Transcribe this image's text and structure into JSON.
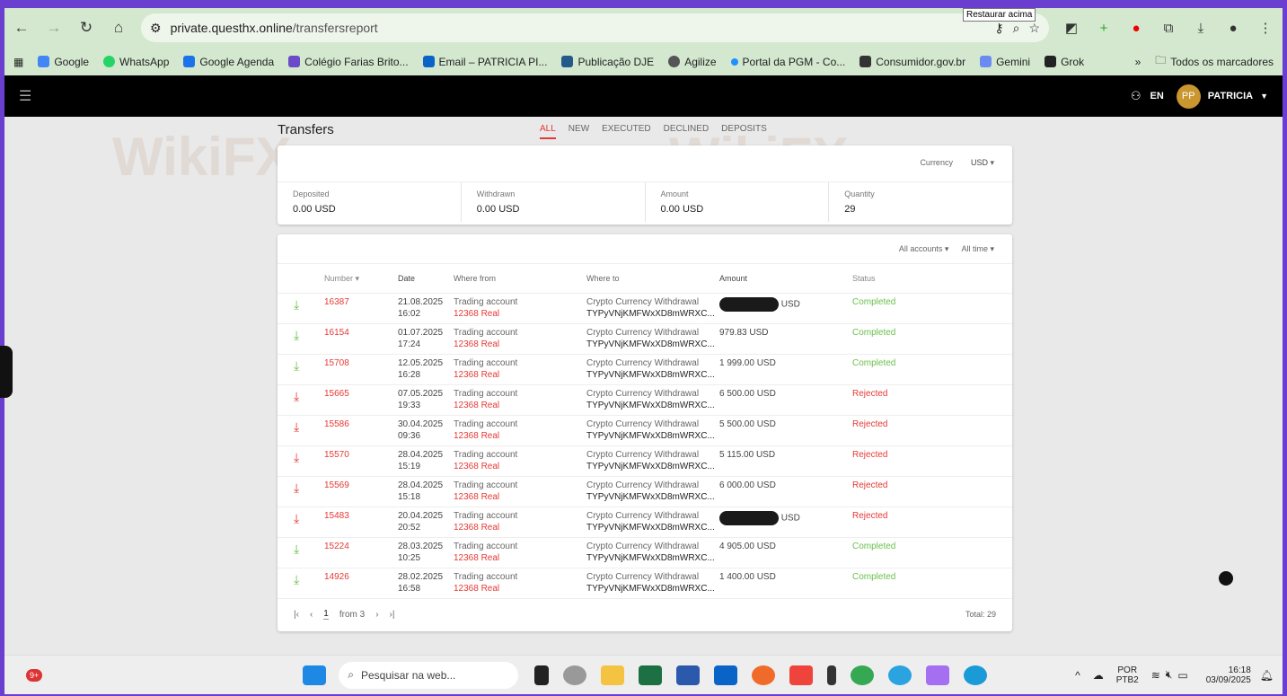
{
  "browser": {
    "url_host": "private.questhx.online",
    "url_path": "/transfersreport",
    "tooltip": "Restaurar acima",
    "bookmarks": [
      "Google",
      "WhatsApp",
      "Google Agenda",
      "Colégio Farias Brito...",
      "Email – PATRICIA PI...",
      "Publicação DJE",
      "Agilize",
      "Portal da PGM - Co...",
      "Consumidor.gov.br",
      "Gemini",
      "Grok"
    ],
    "overflow": "»",
    "all_bookmarks": "Todos os marcadores"
  },
  "header": {
    "lang": "EN",
    "avatar": "PP",
    "user": "PATRICIA"
  },
  "page": {
    "title": "Transfers",
    "tabs": [
      "ALL",
      "NEW",
      "EXECUTED",
      "DECLINED",
      "DEPOSITS"
    ]
  },
  "summary": {
    "currency_label": "Currency",
    "currency": "USD",
    "stats": [
      {
        "label": "Deposited",
        "value": "0.00 USD"
      },
      {
        "label": "Withdrawn",
        "value": "0.00 USD"
      },
      {
        "label": "Amount",
        "value": "0.00 USD"
      },
      {
        "label": "Quantity",
        "value": "29"
      }
    ]
  },
  "table": {
    "filters": [
      "All accounts",
      "All time"
    ],
    "headers": [
      "Number",
      "Date",
      "Where from",
      "Where to",
      "Amount",
      "Status"
    ],
    "rows": [
      {
        "dir": "in",
        "number": "16387",
        "date": "21.08.2025",
        "time": "16:02",
        "from": "Trading account",
        "acct": "12368 Real",
        "to": "Crypto Currency Withdrawal",
        "addr": "TYPyVNjKMFWxXD8mWRXC...",
        "amount": "USD",
        "redacted": true,
        "status": "Completed"
      },
      {
        "dir": "in",
        "number": "16154",
        "date": "01.07.2025",
        "time": "17:24",
        "from": "Trading account",
        "acct": "12368 Real",
        "to": "Crypto Currency Withdrawal",
        "addr": "TYPyVNjKMFWxXD8mWRXC...",
        "amount": "979.83 USD",
        "status": "Completed"
      },
      {
        "dir": "in",
        "number": "15708",
        "date": "12.05.2025",
        "time": "16:28",
        "from": "Trading account",
        "acct": "12368 Real",
        "to": "Crypto Currency Withdrawal",
        "addr": "TYPyVNjKMFWxXD8mWRXC...",
        "amount": "1 999.00 USD",
        "status": "Completed"
      },
      {
        "dir": "out",
        "number": "15665",
        "date": "07.05.2025",
        "time": "19:33",
        "from": "Trading account",
        "acct": "12368 Real",
        "to": "Crypto Currency Withdrawal",
        "addr": "TYPyVNjKMFWxXD8mWRXC...",
        "amount": "6 500.00 USD",
        "status": "Rejected"
      },
      {
        "dir": "out",
        "number": "15586",
        "date": "30.04.2025",
        "time": "09:36",
        "from": "Trading account",
        "acct": "12368 Real",
        "to": "Crypto Currency Withdrawal",
        "addr": "TYPyVNjKMFWxXD8mWRXC...",
        "amount": "5 500.00 USD",
        "status": "Rejected"
      },
      {
        "dir": "out",
        "number": "15570",
        "date": "28.04.2025",
        "time": "15:19",
        "from": "Trading account",
        "acct": "12368 Real",
        "to": "Crypto Currency Withdrawal",
        "addr": "TYPyVNjKMFWxXD8mWRXC...",
        "amount": "5 115.00 USD",
        "status": "Rejected"
      },
      {
        "dir": "out",
        "number": "15569",
        "date": "28.04.2025",
        "time": "15:18",
        "from": "Trading account",
        "acct": "12368 Real",
        "to": "Crypto Currency Withdrawal",
        "addr": "TYPyVNjKMFWxXD8mWRXC...",
        "amount": "6 000.00 USD",
        "status": "Rejected"
      },
      {
        "dir": "out",
        "number": "15483",
        "date": "20.04.2025",
        "time": "20:52",
        "from": "Trading account",
        "acct": "12368 Real",
        "to": "Crypto Currency Withdrawal",
        "addr": "TYPyVNjKMFWxXD8mWRXC...",
        "amount": "USD",
        "redacted": true,
        "status": "Rejected"
      },
      {
        "dir": "in",
        "number": "15224",
        "date": "28.03.2025",
        "time": "10:25",
        "from": "Trading account",
        "acct": "12368 Real",
        "to": "Crypto Currency Withdrawal",
        "addr": "TYPyVNjKMFWxXD8mWRXC...",
        "amount": "4 905.00 USD",
        "status": "Completed"
      },
      {
        "dir": "in",
        "number": "14926",
        "date": "28.02.2025",
        "time": "16:58",
        "from": "Trading account",
        "acct": "12368 Real",
        "to": "Crypto Currency Withdrawal",
        "addr": "TYPyVNjKMFWxXD8mWRXC...",
        "amount": "1 400.00 USD",
        "status": "Completed"
      }
    ],
    "pagination": {
      "page": "1",
      "of": "from 3",
      "total": "Total: 29"
    }
  },
  "watermark": "WikiFX",
  "taskbar": {
    "badge": "9+",
    "search": "Pesquisar na web...",
    "lang1": "POR",
    "lang2": "PTB2",
    "time": "16:18",
    "date": "03/09/2025"
  },
  "colors": {
    "completed": "#6abf4b",
    "rejected": "#e53935",
    "accent": "#e53935"
  }
}
